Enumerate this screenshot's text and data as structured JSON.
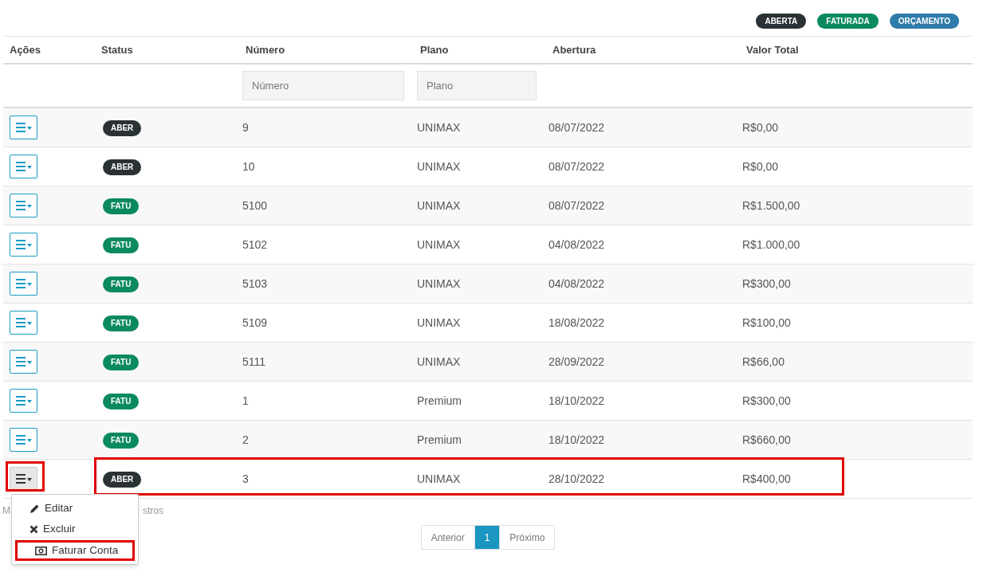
{
  "legend": [
    {
      "label": "ABERTA",
      "color": "#2a3235"
    },
    {
      "label": "FATURADA",
      "color": "#0b8a5e"
    },
    {
      "label": "ORÇAMENTO",
      "color": "#2f7bab"
    }
  ],
  "table": {
    "columns": [
      "Ações",
      "Status",
      "Número",
      "Plano",
      "Abertura",
      "Valor Total"
    ],
    "filters": [
      {
        "placeholder": "Número"
      },
      {
        "placeholder": "Plano"
      }
    ],
    "rows": [
      {
        "status": "ABER",
        "color": "#2a3235",
        "numero": "9",
        "plano": "UNIMAX",
        "abertura": "08/07/2022",
        "valor": "R$0,00",
        "highlighted": false,
        "menu_open": false
      },
      {
        "status": "ABER",
        "color": "#2a3235",
        "numero": "10",
        "plano": "UNIMAX",
        "abertura": "08/07/2022",
        "valor": "R$0,00",
        "highlighted": false,
        "menu_open": false
      },
      {
        "status": "FATU",
        "color": "#0b8a5e",
        "numero": "5100",
        "plano": "UNIMAX",
        "abertura": "08/07/2022",
        "valor": "R$1.500,00",
        "highlighted": false,
        "menu_open": false
      },
      {
        "status": "FATU",
        "color": "#0b8a5e",
        "numero": "5102",
        "plano": "UNIMAX",
        "abertura": "04/08/2022",
        "valor": "R$1.000,00",
        "highlighted": false,
        "menu_open": false
      },
      {
        "status": "FATU",
        "color": "#0b8a5e",
        "numero": "5103",
        "plano": "UNIMAX",
        "abertura": "04/08/2022",
        "valor": "R$300,00",
        "highlighted": false,
        "menu_open": false
      },
      {
        "status": "FATU",
        "color": "#0b8a5e",
        "numero": "5109",
        "plano": "UNIMAX",
        "abertura": "18/08/2022",
        "valor": "R$100,00",
        "highlighted": false,
        "menu_open": false
      },
      {
        "status": "FATU",
        "color": "#0b8a5e",
        "numero": "5111",
        "plano": "UNIMAX",
        "abertura": "28/09/2022",
        "valor": "R$66,00",
        "highlighted": false,
        "menu_open": false
      },
      {
        "status": "FATU",
        "color": "#0b8a5e",
        "numero": "1",
        "plano": "Premium",
        "abertura": "18/10/2022",
        "valor": "R$300,00",
        "highlighted": false,
        "menu_open": false
      },
      {
        "status": "FATU",
        "color": "#0b8a5e",
        "numero": "2",
        "plano": "Premium",
        "abertura": "18/10/2022",
        "valor": "R$660,00",
        "highlighted": false,
        "menu_open": false
      },
      {
        "status": "ABER",
        "color": "#2a3235",
        "numero": "3",
        "plano": "UNIMAX",
        "abertura": "28/10/2022",
        "valor": "R$400,00",
        "highlighted": true,
        "menu_open": true
      }
    ]
  },
  "info": {
    "start": "M",
    "end": "stros"
  },
  "menu": [
    {
      "kind": "edit",
      "label": "Editar",
      "highlighted": false
    },
    {
      "kind": "delete",
      "label": "Excluir",
      "highlighted": false
    },
    {
      "kind": "bill",
      "label": "Faturar Conta",
      "highlighted": true
    }
  ],
  "pagination": [
    {
      "label": "Anterior",
      "selected": false
    },
    {
      "label": "1",
      "selected": true
    },
    {
      "label": "Próximo",
      "selected": false
    }
  ]
}
